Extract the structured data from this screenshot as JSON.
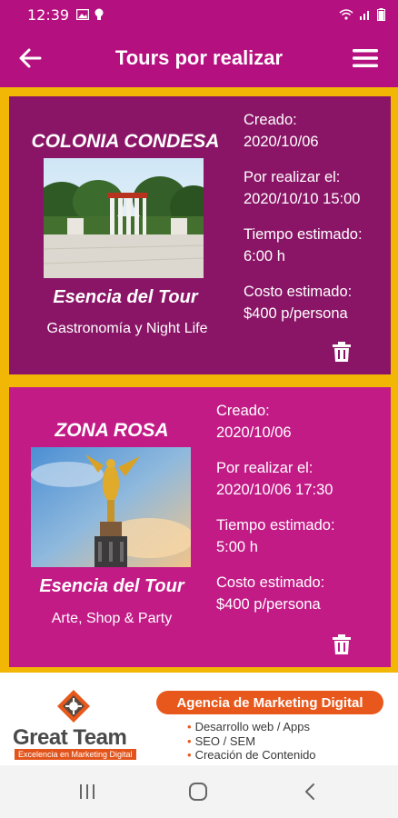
{
  "status_bar": {
    "time": "12:39",
    "icons": [
      "image-icon",
      "bulb-icon",
      "wifi-icon",
      "signal-icon",
      "battery-icon"
    ]
  },
  "app_bar": {
    "title": "Tours por realizar",
    "back_icon": "arrow-left-icon",
    "menu_icon": "hamburger-menu-icon"
  },
  "colors": {
    "primary": "#b5107f",
    "card_dark": "#8a1566",
    "card_light": "#c21b86",
    "list_background": "#f2b705",
    "ad_accent": "#e8581c"
  },
  "tours": [
    {
      "name": "COLONIA CONDESA",
      "photo": "monument-park-photo",
      "essence_label": "Esencia del Tour",
      "category": "Gastronomía y Night Life",
      "created_label": "Creado:",
      "created": "2020/10/06",
      "scheduled_label": "Por realizar el:",
      "scheduled": "2020/10/10 15:00",
      "time_label": "Tiempo estimado:",
      "time": "6:00 h",
      "cost_label": "Costo estimado:",
      "cost": "$400 p/persona",
      "delete_icon": "trash-icon"
    },
    {
      "name": "ZONA ROSA",
      "photo": "angel-independence-photo",
      "essence_label": "Esencia del Tour",
      "category": "Arte, Shop & Party",
      "created_label": "Creado:",
      "created": "2020/10/06",
      "scheduled_label": "Por realizar el:",
      "scheduled": "2020/10/06 17:30",
      "time_label": "Tiempo estimado:",
      "time": "5:00 h",
      "cost_label": "Costo estimado:",
      "cost": "$400 p/persona",
      "delete_icon": "trash-icon"
    }
  ],
  "ad": {
    "brand": "Great Team",
    "brand_tagline": "Excelencia en Marketing Digital",
    "headline": "Agencia de Marketing Digital",
    "bullets": [
      "Desarrollo web / Apps",
      "SEO / SEM",
      "Creación de Contenido"
    ]
  },
  "nav_bar": {
    "icons": [
      "recent-apps-icon",
      "home-icon",
      "back-icon"
    ]
  }
}
